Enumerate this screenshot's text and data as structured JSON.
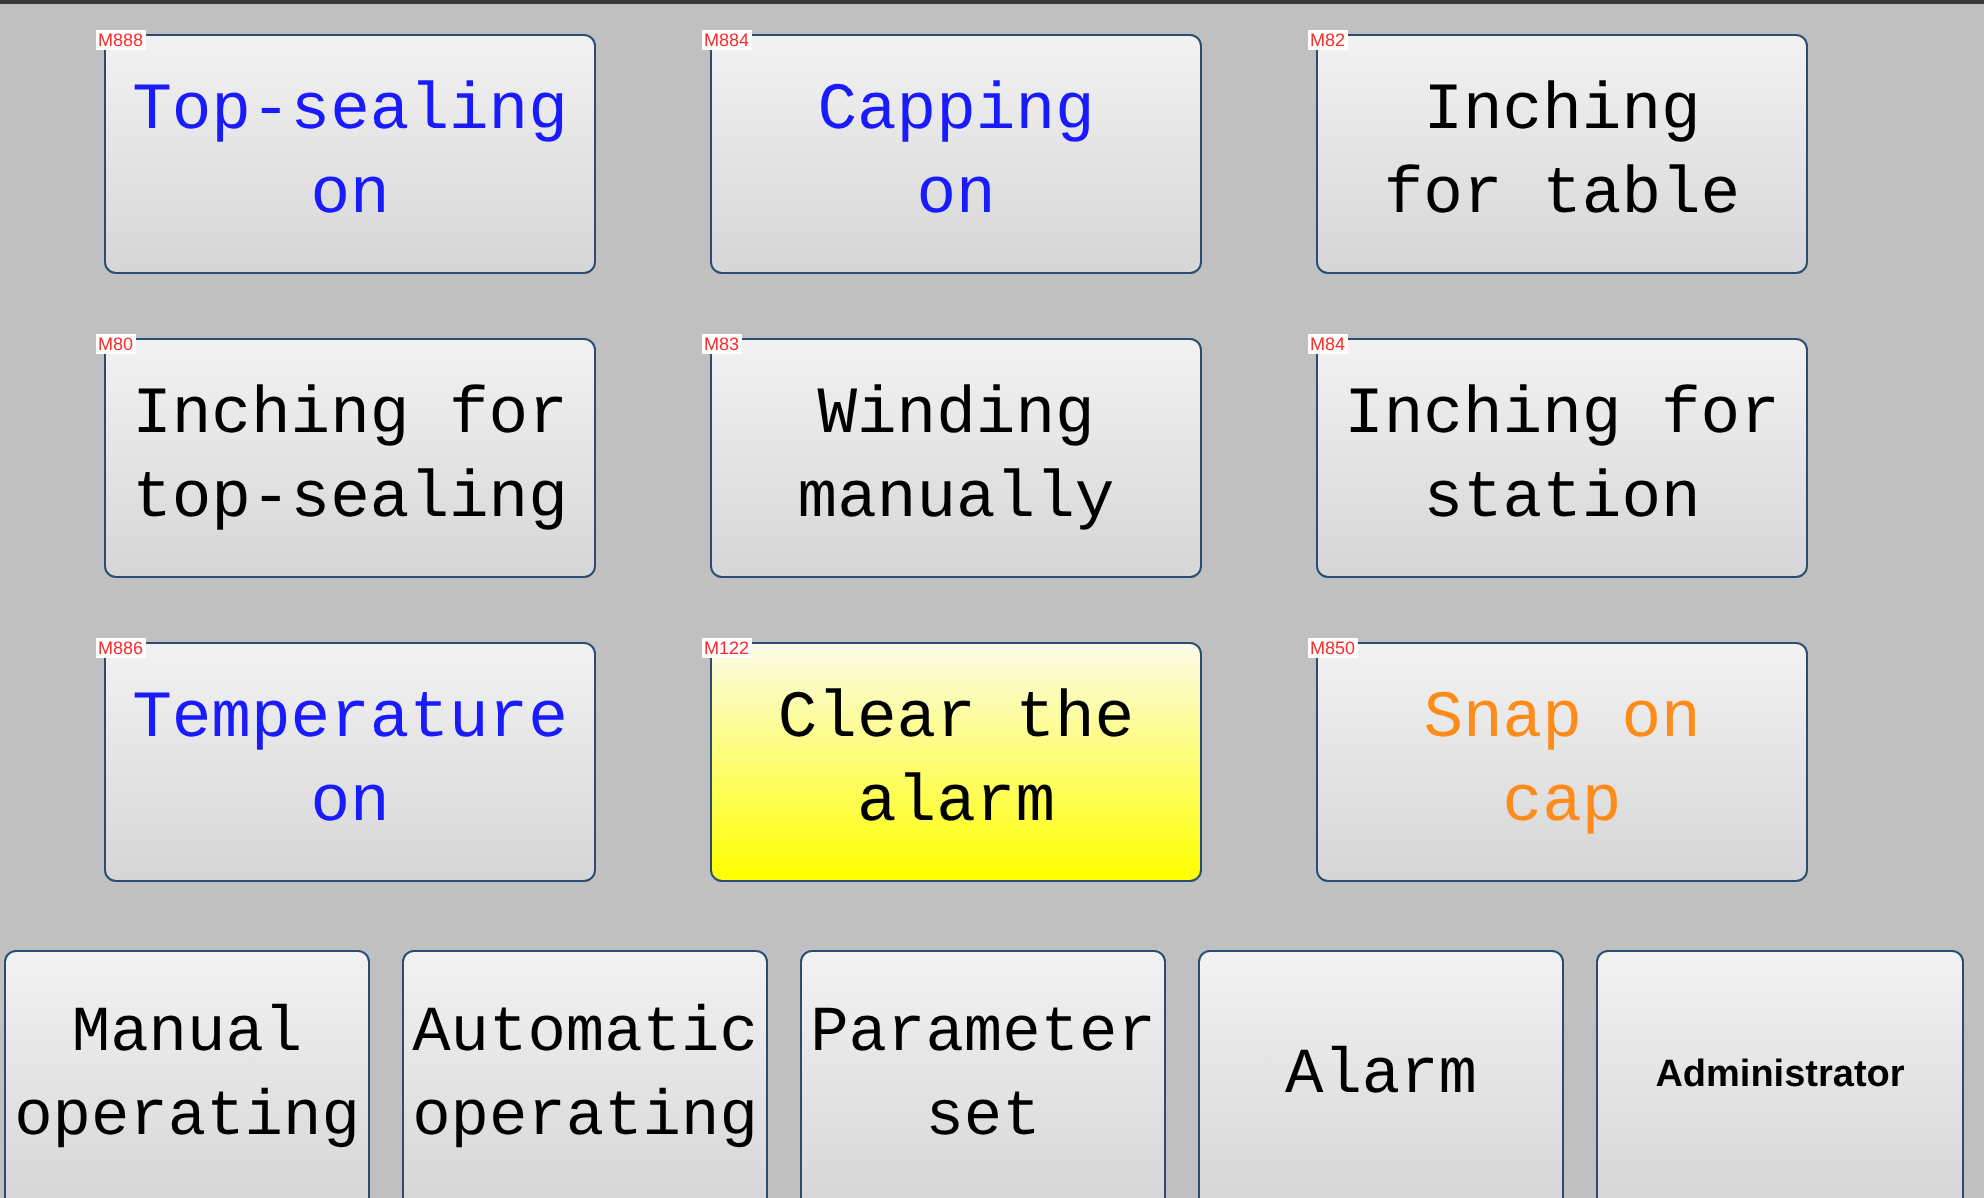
{
  "function_buttons": [
    {
      "tag": "M888",
      "label": "Top-sealing\non",
      "kind": "switch",
      "active": false
    },
    {
      "tag": "M884",
      "label": "Capping\non",
      "kind": "switch",
      "active": false
    },
    {
      "tag": "M82",
      "label": "Inching\nfor table",
      "kind": "manual",
      "active": false
    },
    {
      "tag": "M80",
      "label": "Inching for\ntop-sealing",
      "kind": "manual",
      "active": false
    },
    {
      "tag": "M83",
      "label": "Winding\nmanually",
      "kind": "manual",
      "active": false
    },
    {
      "tag": "M84",
      "label": "Inching for\nstation",
      "kind": "manual",
      "active": false
    },
    {
      "tag": "M886",
      "label": "Temperature\non",
      "kind": "switch",
      "active": false
    },
    {
      "tag": "M122",
      "label": "Clear the\nalarm",
      "kind": "manual",
      "active": true
    },
    {
      "tag": "M850",
      "label": "Snap on\ncap",
      "kind": "special",
      "active": false
    }
  ],
  "nav_buttons": [
    {
      "label": "Manual\noperating",
      "kind": "large"
    },
    {
      "label": "Automatic\noperating",
      "kind": "large"
    },
    {
      "label": "Parameter\nset",
      "kind": "large"
    },
    {
      "label": "Alarm",
      "kind": "large"
    },
    {
      "label": "Administrator",
      "kind": "small"
    }
  ]
}
